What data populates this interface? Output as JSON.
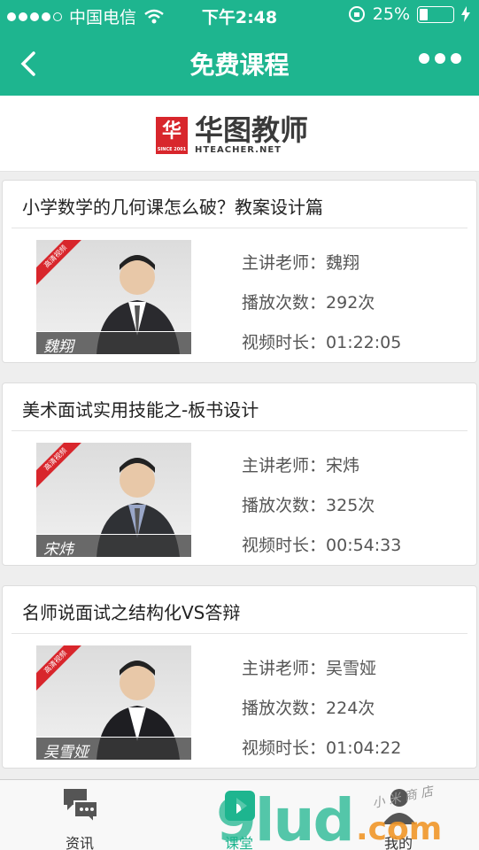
{
  "status": {
    "carrier": "中国电信",
    "time": "下午2:48",
    "battery": "25%",
    "battery_level": 0.25
  },
  "nav": {
    "title": "免费课程"
  },
  "brand": {
    "name_cn": "华图教师",
    "name_en": "HTEACHER.NET",
    "mark": "华",
    "since": "SINCE 2001"
  },
  "labels": {
    "teacher": "主讲老师：",
    "plays": "播放次数：",
    "duration": "视频时长："
  },
  "thumb_tag": "高清视频",
  "courses": [
    {
      "title": "小学数学的几何课怎么破？教案设计篇",
      "teacher": "魏翔",
      "plays": "292次",
      "duration": "01:22:05",
      "signature": "魏翔"
    },
    {
      "title": "美术面试实用技能之-板书设计",
      "teacher": "宋炜",
      "plays": "325次",
      "duration": "00:54:33",
      "signature": "宋炜"
    },
    {
      "title": "名师说面试之结构化VS答辩",
      "teacher": "吴雪娅",
      "plays": "224次",
      "duration": "01:04:22",
      "signature": "吴雪娅"
    }
  ],
  "tabs": [
    {
      "label": "资讯",
      "icon": "chat-icon"
    },
    {
      "label": "课堂",
      "icon": "play-icon"
    },
    {
      "label": "我的",
      "icon": "user-icon"
    }
  ],
  "watermark": {
    "main": "9lud",
    "suffix": ".com",
    "small": "小 米 商 店"
  },
  "colors": {
    "accent": "#1eb58f",
    "brand_red": "#d8262c"
  }
}
